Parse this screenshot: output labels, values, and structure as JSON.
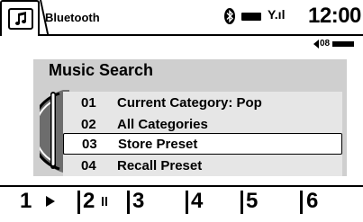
{
  "header": {
    "title": "Bluetooth",
    "time": "12:00",
    "signal": "Y.ıl"
  },
  "volume": {
    "level": "08"
  },
  "panel": {
    "title": "Music Search",
    "items": [
      {
        "num": "01",
        "label": "Current Category: Pop"
      },
      {
        "num": "02",
        "label": "All Categories"
      },
      {
        "num": "03",
        "label": "Store Preset"
      },
      {
        "num": "04",
        "label": "Recall Preset"
      }
    ],
    "selected_index": 2
  },
  "presets": [
    {
      "label": "1"
    },
    {
      "label": "2"
    },
    {
      "label": "3"
    },
    {
      "label": "4"
    },
    {
      "label": "5"
    },
    {
      "label": "6"
    }
  ],
  "icons": {
    "source": "music-note-icon",
    "bluetooth": "bluetooth-icon",
    "battery": "battery-icon",
    "speaker": "speaker-icon",
    "play": "play-icon",
    "pause": "pause-icon"
  },
  "colors": {
    "panel_bg": "#cfcfcf",
    "row_bg": "#e6e6e6",
    "selected_bg": "#ffffff"
  }
}
